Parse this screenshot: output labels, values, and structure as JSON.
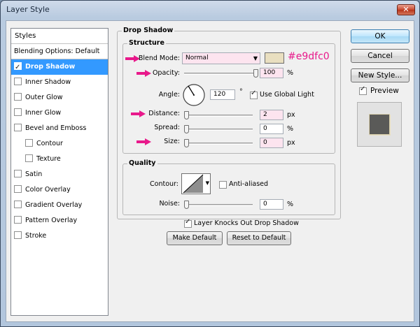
{
  "window": {
    "title": "Layer Style",
    "close_glyph": "✕"
  },
  "styles": {
    "header": "Styles",
    "blending_label": "Blending Options: Default",
    "items": [
      {
        "label": "Drop Shadow",
        "checked": true,
        "selected": true,
        "sub": false
      },
      {
        "label": "Inner Shadow",
        "checked": false,
        "selected": false,
        "sub": false
      },
      {
        "label": "Outer Glow",
        "checked": false,
        "selected": false,
        "sub": false
      },
      {
        "label": "Inner Glow",
        "checked": false,
        "selected": false,
        "sub": false
      },
      {
        "label": "Bevel and Emboss",
        "checked": false,
        "selected": false,
        "sub": false
      },
      {
        "label": "Contour",
        "checked": false,
        "selected": false,
        "sub": true
      },
      {
        "label": "Texture",
        "checked": false,
        "selected": false,
        "sub": true
      },
      {
        "label": "Satin",
        "checked": false,
        "selected": false,
        "sub": false
      },
      {
        "label": "Color Overlay",
        "checked": false,
        "selected": false,
        "sub": false
      },
      {
        "label": "Gradient Overlay",
        "checked": false,
        "selected": false,
        "sub": false
      },
      {
        "label": "Pattern Overlay",
        "checked": false,
        "selected": false,
        "sub": false
      },
      {
        "label": "Stroke",
        "checked": false,
        "selected": false,
        "sub": false
      }
    ]
  },
  "drop_shadow": {
    "title": "Drop Shadow",
    "structure": {
      "title": "Structure",
      "blend_mode_label": "Blend Mode:",
      "blend_mode_value": "Normal",
      "shadow_color": "#e9dfc0",
      "color_annotation": "#e9dfc0",
      "opacity_label": "Opacity:",
      "opacity_value": "100",
      "opacity_fraction": 1.0,
      "percent": "%",
      "angle_label": "Angle:",
      "angle_value": "120",
      "degree": "°",
      "use_global_light_label": "Use Global Light",
      "use_global_light": true,
      "distance_label": "Distance:",
      "distance_value": "2",
      "distance_fraction": 0.0,
      "spread_label": "Spread:",
      "spread_value": "0",
      "spread_fraction": 0.0,
      "size_label": "Size:",
      "size_value": "0",
      "size_fraction": 0.0,
      "px": "px"
    },
    "quality": {
      "title": "Quality",
      "contour_label": "Contour:",
      "anti_aliased_label": "Anti-aliased",
      "anti_aliased": false,
      "noise_label": "Noise:",
      "noise_value": "0",
      "noise_fraction": 0.0,
      "percent": "%"
    },
    "knocks_out_label": "Layer Knocks Out Drop Shadow",
    "knocks_out": true,
    "make_default_label": "Make Default",
    "reset_default_label": "Reset to Default"
  },
  "buttons": {
    "ok_label": "OK",
    "cancel_label": "Cancel",
    "new_style_label": "New Style...",
    "preview_label": "Preview",
    "preview_checked": true
  },
  "colors": {
    "annotation_pink": "#e8198b",
    "selection_blue": "#3399ff",
    "preview_swatch": "#5a5a58"
  }
}
